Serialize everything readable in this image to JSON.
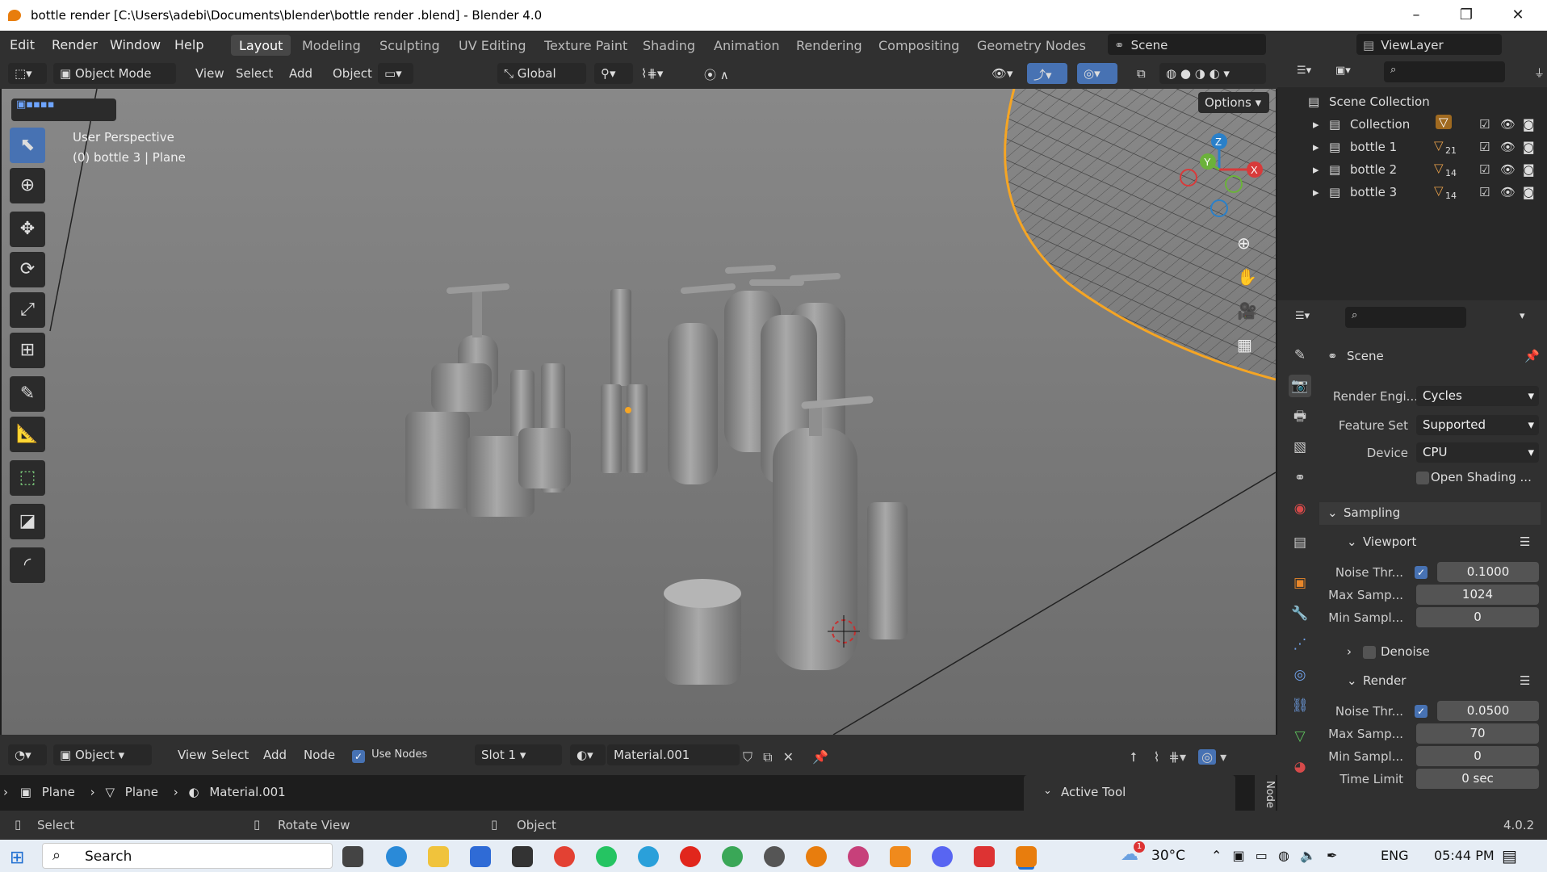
{
  "titlebar": {
    "title": "bottle render  [C:\\Users\\adebi\\Documents\\blender\\bottle render .blend] - Blender 4.0",
    "min": "–",
    "max": "❐",
    "close": "✕"
  },
  "menus": [
    "Edit",
    "Render",
    "Window",
    "Help"
  ],
  "workspaces": [
    {
      "label": "Layout",
      "active": true
    },
    {
      "label": "Modeling"
    },
    {
      "label": "Sculpting"
    },
    {
      "label": "UV Editing"
    },
    {
      "label": "Texture Paint"
    },
    {
      "label": "Shading"
    },
    {
      "label": "Animation"
    },
    {
      "label": "Rendering"
    },
    {
      "label": "Compositing"
    },
    {
      "label": "Geometry Nodes"
    }
  ],
  "scene_field": "Scene",
  "viewlayer_field": "ViewLayer",
  "viewport_header": {
    "mode": "Object Mode",
    "menus": [
      "View",
      "Select",
      "Add",
      "Object"
    ],
    "orientation": "Global",
    "options": "Options"
  },
  "viewport_overlay": {
    "line1": "User Perspective",
    "line2": "(0) bottle 3  | Plane"
  },
  "gizmo": {
    "z": "Z",
    "y": "Y",
    "x": "X"
  },
  "outliner": {
    "root": "Scene Collection",
    "items": [
      {
        "name": "Collection",
        "count": ""
      },
      {
        "name": "bottle 1",
        "count": "21"
      },
      {
        "name": "bottle 2",
        "count": "14"
      },
      {
        "name": "bottle 3",
        "count": "14"
      }
    ]
  },
  "properties": {
    "title": "Scene",
    "render_engine_label": "Render Engi...",
    "render_engine": "Cycles",
    "feature_set_label": "Feature Set",
    "feature_set": "Supported",
    "device_label": "Device",
    "device": "CPU",
    "osl_label": "Open Shading ...",
    "sampling": "Sampling",
    "viewport": "Viewport",
    "vp_noise_label": "Noise Thr...",
    "vp_noise": "0.1000",
    "vp_max_label": "Max Samp...",
    "vp_max": "1024",
    "vp_min_label": "Min Sampl...",
    "vp_min": "0",
    "denoise": "Denoise",
    "render": "Render",
    "r_noise_label": "Noise Thr...",
    "r_noise": "0.0500",
    "r_max_label": "Max Samp...",
    "r_max": "70",
    "r_min_label": "Min Sampl...",
    "r_min": "0",
    "time_limit_label": "Time Limit",
    "time_limit": "0 sec"
  },
  "node_header": {
    "editor": "Object",
    "menus": [
      "View",
      "Select",
      "Add",
      "Node"
    ],
    "use_nodes": "Use Nodes",
    "slot": "Slot 1",
    "material": "Material.001"
  },
  "breadcrumb": {
    "a": "Plane",
    "b": "Plane",
    "c": "Material.001"
  },
  "active_tool": "Active Tool",
  "node_tab": "Node",
  "statusbar": {
    "select": "Select",
    "rotate": "Rotate View",
    "object": "Object",
    "version": "4.0.2"
  },
  "taskbar": {
    "search": "Search",
    "temp": "30°C",
    "lang": "ENG",
    "time": "05:44 PM",
    "badge": "1"
  },
  "colors": {
    "accent": "#4772b3",
    "orange": "#e87d0d",
    "panel": "#303030"
  }
}
